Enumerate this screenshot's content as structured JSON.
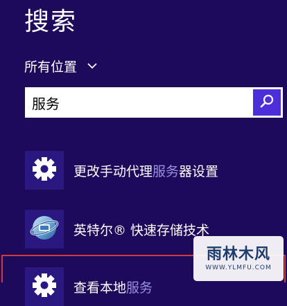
{
  "page_title": "搜索",
  "scope": {
    "label": "所有位置"
  },
  "search": {
    "value": "服务"
  },
  "results": [
    {
      "label_before": "更改手动代理",
      "label_highlight": "服务",
      "label_after": "器设置",
      "icon": "gear-icon"
    },
    {
      "label_before": "英特尔® 快速存储技术",
      "label_highlight": "",
      "label_after": "",
      "icon": "intel-rst-icon"
    },
    {
      "label_before": "查看本地",
      "label_highlight": "服务",
      "label_after": "",
      "icon": "gear-icon"
    }
  ],
  "watermark": {
    "main": "雨林木风",
    "sub": "WWW.YLMFU.COM"
  },
  "colors": {
    "background": "#1e0a5a",
    "tile": "#2a1780",
    "search_button": "#4e2ed9",
    "highlight_text": "#9a8fe0",
    "selection_border": "#d43a3a"
  }
}
